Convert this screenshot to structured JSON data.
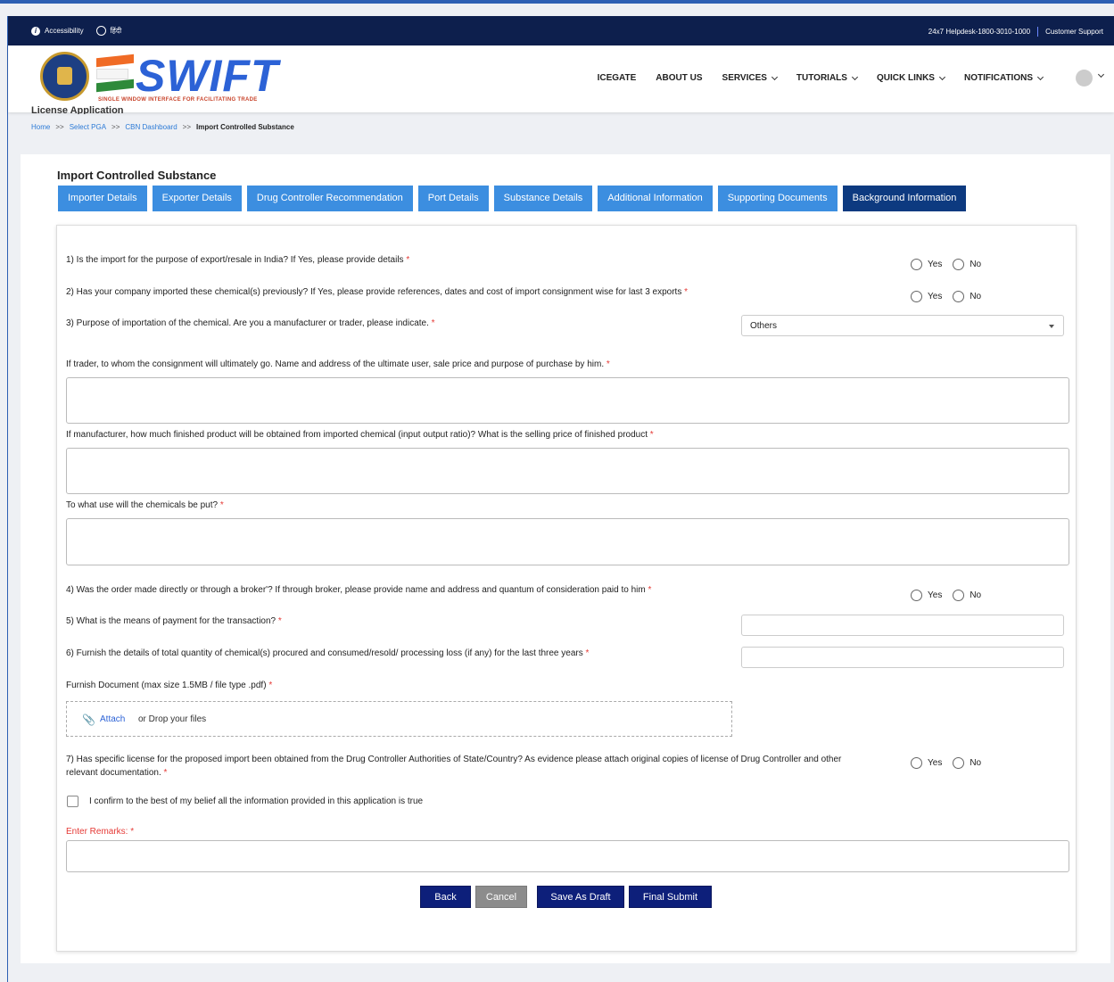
{
  "topbar": {
    "accessibility": "Accessibility",
    "language": "हिंदी",
    "helpdesk": "24x7 Helpdesk-1800-3010-1000",
    "support": "Customer Support"
  },
  "header": {
    "logo_text": "SWIFT",
    "logo_subtitle": "SINGLE WINDOW INTERFACE FOR FACILITATING TRADE",
    "nav": [
      {
        "label": "ICEGATE"
      },
      {
        "label": "ABOUT US"
      },
      {
        "label": "SERVICES"
      },
      {
        "label": "TUTORIALS"
      },
      {
        "label": "QUICK LINKS"
      },
      {
        "label": "NOTIFICATIONS"
      }
    ]
  },
  "page": {
    "subheading": "License Application",
    "breadcrumb": [
      "Home",
      "Select PGA",
      "CBN Dashboard",
      "Import Controlled Substance"
    ],
    "breadcrumb_sep": ">>",
    "title": "Import Controlled Substance"
  },
  "tabs": [
    {
      "label": "Importer Details"
    },
    {
      "label": "Exporter Details"
    },
    {
      "label": "Drug Controller Recommendation"
    },
    {
      "label": "Port Details"
    },
    {
      "label": "Substance Details"
    },
    {
      "label": "Additional Information"
    },
    {
      "label": "Supporting Documents"
    },
    {
      "label": "Background Information",
      "active": true
    }
  ],
  "form": {
    "q1": "1) Is the import for the purpose of export/resale in India? If Yes, please provide details",
    "q2": "2) Has your company imported these chemical(s) previously? If Yes, please provide references, dates and cost of import consignment wise for last 3 exports",
    "q3": "3) Purpose of importation of the chemical. Are you a manufacturer or trader, please indicate.",
    "q3_selected": "Others",
    "trader": "If trader, to whom the consignment will ultimately go. Name and address of the ultimate user, sale price and purpose of purchase by him.",
    "manufacturer": "If manufacturer, how much finished product will be obtained from imported chemical (input output ratio)? What is the selling price of finished product",
    "use": "To what use will the chemicals be put?",
    "q4": "4) Was the order made directly or through a broker'? If through broker, please provide name and address and quantum of consideration paid to him",
    "q5": "5) What is the means of payment for the transaction?",
    "q6": "6) Furnish the details of total quantity of chemical(s) procured and consumed/resold/ processing loss (if any) for the last three years",
    "doc_label": "Furnish Document (max size 1.5MB / file type .pdf)",
    "attach": "Attach",
    "drop": "or Drop your files",
    "q7_line1": "7) Has specific license for the proposed import been obtained from the Drug Controller Authorities of State/Country? As evidence please attach original copies of license of Drug Controller and other",
    "q7_line2": "relevant documentation.",
    "confirm": "I confirm to the best of my belief all the information provided in this application is true",
    "remarks": "Enter Remarks:",
    "required": "*",
    "yes": "Yes",
    "no": "No"
  },
  "buttons": {
    "back": "Back",
    "cancel": "Cancel",
    "draft": "Save As Draft",
    "submit": "Final Submit"
  }
}
